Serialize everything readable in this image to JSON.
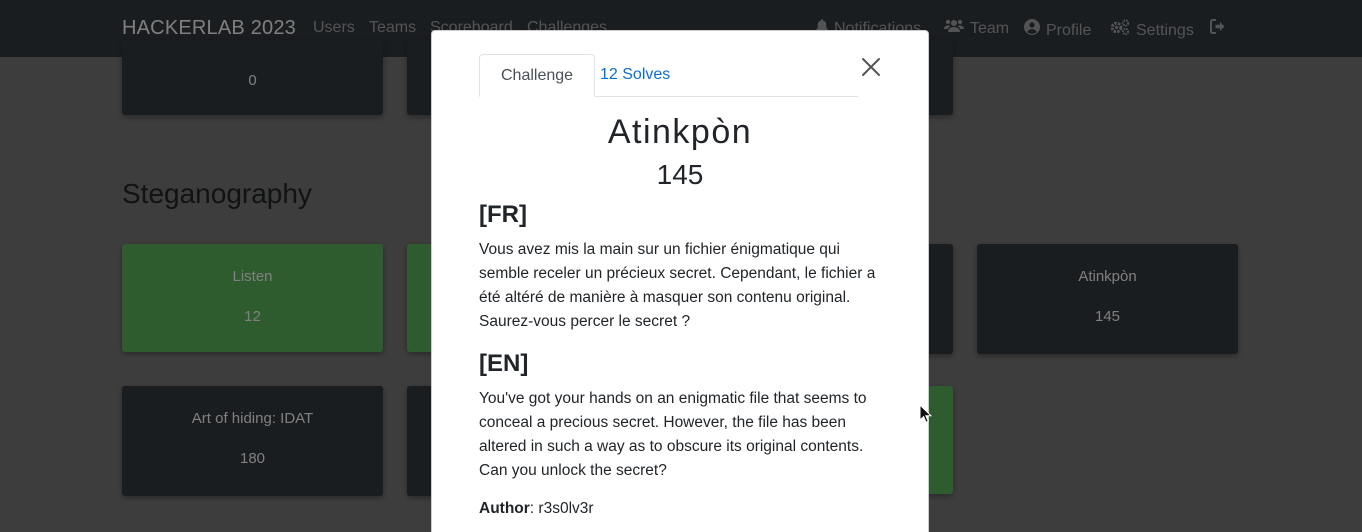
{
  "navbar": {
    "brand": "HACKERLAB 2023",
    "left_links": [
      "Users",
      "Teams",
      "Scoreboard",
      "Challenges"
    ],
    "notifications": "Notifications",
    "team": "Team",
    "profile": "Profile",
    "settings": "Settings"
  },
  "page": {
    "top_row": [
      {
        "value": "0"
      },
      {
        "value": ""
      }
    ],
    "section_title": "Steganography",
    "row1": [
      {
        "name": "Listen",
        "value": "12",
        "solved": true
      },
      {
        "name": "",
        "value": "",
        "solved": true
      },
      {
        "name": "",
        "value": "",
        "solved": false
      },
      {
        "name": "Atinkpòn",
        "value": "145",
        "solved": false
      }
    ],
    "row2": [
      {
        "name": "Art of hiding: IDAT",
        "value": "180",
        "solved": false
      },
      {
        "name": "",
        "value": "",
        "solved": false
      },
      {
        "name": "",
        "value": "",
        "solved": true
      }
    ]
  },
  "modal": {
    "tab_challenge": "Challenge",
    "tab_solves": "12 Solves",
    "name": "Atinkpòn",
    "value": "145",
    "fr_heading": "[FR]",
    "fr_text": "Vous avez mis la main sur un fichier énigmatique qui semble receler un précieux secret. Cependant, le fichier a été altéré de manière à masquer son contenu original. Saurez-vous percer le secret ?",
    "en_heading": "[EN]",
    "en_text": "You've got your hands on an enigmatic file that seems to conceal a precious secret. However, the file has been altered in such a way as to obscure its original contents. Can you unlock the secret?",
    "author_label": "Author",
    "author": "r3s0lv3r"
  },
  "colors": {
    "navbar": "#343a40",
    "card_dark": "#343a40",
    "card_solved": "#5cb85c",
    "tab_link": "#0a6ed1"
  }
}
